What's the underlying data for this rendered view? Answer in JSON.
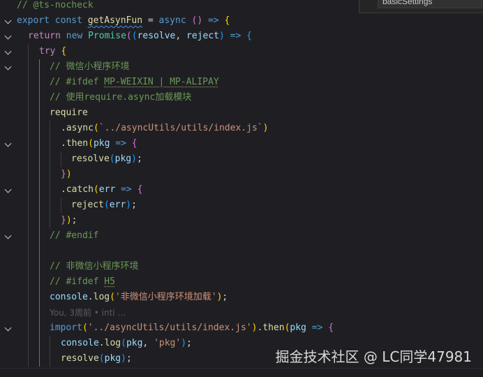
{
  "find_widget": {
    "query": "basicSettings"
  },
  "code_lines": {
    "l0": {
      "comment": "// @ts-nocheck"
    },
    "l1": {
      "kw_export": "export",
      "kw_const": "const",
      "fn_name": "getAsynFun",
      "eq": " = ",
      "kw_async": "async",
      "paren_open": "(",
      "paren_close": ")",
      "arrow": " => ",
      "brace": "{"
    },
    "l2": {
      "kw_return": "return",
      "kw_new": "new",
      "cls": "Promise",
      "p1": "(",
      "p2": "(",
      "resolve": "resolve",
      "comma": ", ",
      "reject": "reject",
      "p3": ")",
      "arrow": " => ",
      "brace": "{"
    },
    "l3": {
      "kw_try": "try",
      "brace": "{"
    },
    "l4": {
      "comment": "// 微信小程序环境"
    },
    "l5": {
      "comment_a": "// #ifdef ",
      "comment_b": "MP-WEIXIN | MP-ALIPAY"
    },
    "l6": {
      "comment": "// 使用require.async加载模块"
    },
    "l7": {
      "fn": "require"
    },
    "l8": {
      "dot": ".",
      "fn": "async",
      "p1": "(",
      "str": "`../asyncUtils/utils/index.js`",
      "p2": ")"
    },
    "l9": {
      "dot": ".",
      "fn": "then",
      "p1": "(",
      "arg": "pkg",
      "arrow": " => ",
      "brace": "{"
    },
    "l10": {
      "fn": "resolve",
      "p1": "(",
      "arg": "pkg",
      "p2": ")",
      "semi": ";"
    },
    "l11": {
      "brace": "}",
      "p": ")"
    },
    "l12": {
      "dot": ".",
      "fn": "catch",
      "p1": "(",
      "arg": "err",
      "arrow": " => ",
      "brace": "{"
    },
    "l13": {
      "fn": "reject",
      "p1": "(",
      "arg": "err",
      "p2": ")",
      "semi": ";"
    },
    "l14": {
      "brace": "}",
      "p": ")",
      "semi": ";"
    },
    "l15": {
      "comment": "// #endif"
    },
    "l16": {},
    "l17": {
      "comment": "// 非微信小程序环境"
    },
    "l18": {
      "comment_a": "// #ifdef ",
      "comment_b": "H5"
    },
    "l19": {
      "obj": "console",
      "dot": ".",
      "fn": "log",
      "p1": "(",
      "str": "'非微信小程序环境加载'",
      "p2": ")",
      "semi": ";"
    },
    "l20": {
      "blame": "You, 3周前 • inti …"
    },
    "l21": {
      "fn": "import",
      "p1": "(",
      "str": "'../asyncUtils/utils/index.js'",
      "p2": ")",
      "dot": ".",
      "fn2": "then",
      "p3": "(",
      "arg": "pkg",
      "arrow": " => ",
      "brace": "{"
    },
    "l22": {
      "obj": "console",
      "dot": ".",
      "fn": "log",
      "p1": "(",
      "arg": "pkg",
      "comma": ", ",
      "str": "'pkg'",
      "p2": ")",
      "semi": ";"
    },
    "l23": {
      "fn": "resolve",
      "p1": "(",
      "arg": "pkg",
      "p2": ")",
      "semi": ";"
    }
  },
  "watermark": "掘金技术社区 @ LC同学47981",
  "colors": {
    "background": "#1f1f23",
    "comment": "#6a9955",
    "keyword": "#569cd6",
    "control": "#c586c0",
    "function": "#dcdcaa",
    "variable": "#9cdcfe",
    "class": "#4ec9b0",
    "string": "#ce9178"
  },
  "icons": {
    "fold": "chevron-down-icon"
  }
}
